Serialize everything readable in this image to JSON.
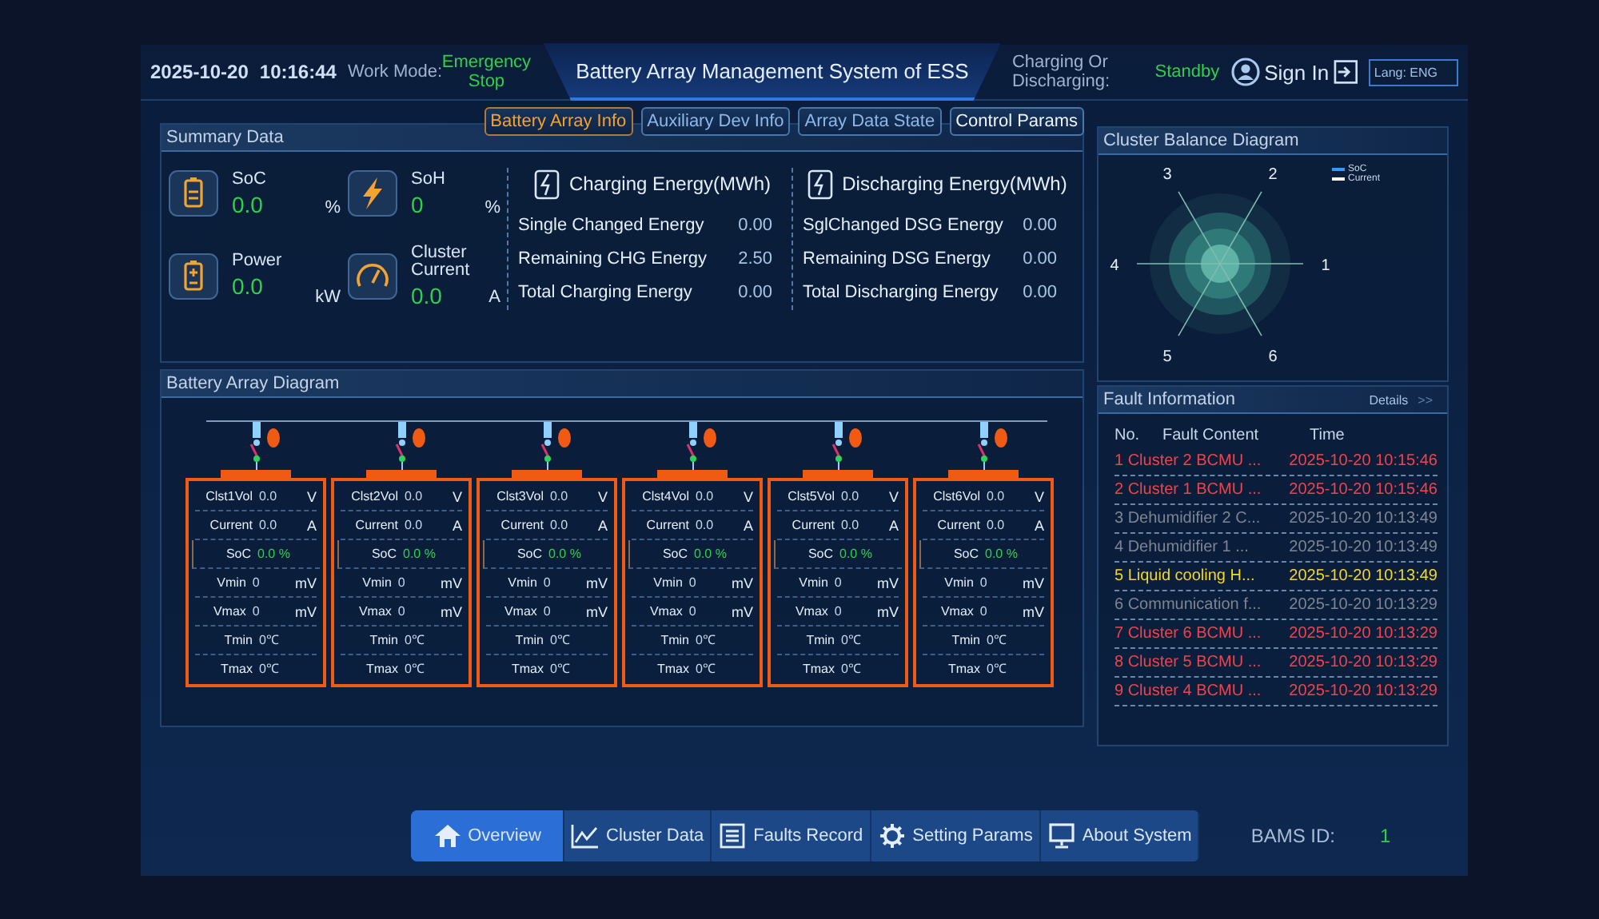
{
  "header": {
    "date": "2025-10-20",
    "time": "10:16:44",
    "work_mode_label": "Work Mode:",
    "work_mode": "Emergency Stop",
    "title": "Battery Array Management System of ESS",
    "charge_label": "Charging Or Discharging:",
    "charge_state": "Standby",
    "sign_in": "Sign In",
    "lang": "Lang: ENG"
  },
  "tabs": [
    {
      "label": "Battery Array Info",
      "selected": true
    },
    {
      "label": "Auxiliary Dev Info",
      "selected": false
    },
    {
      "label": "Array Data State",
      "selected": false
    },
    {
      "label": "Control Params",
      "selected": false
    }
  ],
  "summary": {
    "title": "Summary Data",
    "metrics": [
      {
        "kind": "battery",
        "label": "SoC",
        "value": "0.0",
        "unit": "%"
      },
      {
        "kind": "bolt",
        "label": "SoH",
        "value": "0",
        "unit": "%"
      },
      {
        "kind": "battery-plus",
        "label": "Power",
        "value": "0.0",
        "unit": "kW"
      },
      {
        "kind": "gauge",
        "label": "Cluster Current",
        "value": "0.0",
        "unit": "A"
      }
    ],
    "energy": [
      {
        "title": "Charging Energy(MWh)",
        "rows": [
          [
            "Single Changed Energy",
            "0.00"
          ],
          [
            "Remaining CHG Energy",
            "2.50"
          ],
          [
            "Total Charging Energy",
            "0.00"
          ]
        ]
      },
      {
        "title": "Discharging Energy(MWh)",
        "rows": [
          [
            "SglChanged DSG Energy",
            "0.00"
          ],
          [
            "Remaining DSG Energy",
            "0.00"
          ],
          [
            "Total Discharging Energy",
            "0.00"
          ]
        ]
      }
    ]
  },
  "array": {
    "title": "Battery Array Diagram",
    "clusters": [
      {
        "rows": [
          {
            "kind": "plain",
            "label": "Clst1Vol",
            "value": "0.0",
            "unit": "V"
          },
          {
            "kind": "plain",
            "label": "Current",
            "value": "0.0",
            "unit": "A"
          },
          {
            "kind": "soc",
            "label": "SoC",
            "value": "0.0 %"
          },
          {
            "kind": "plain",
            "label": "Vmin",
            "value": "0",
            "unit": "mV"
          },
          {
            "kind": "plain",
            "label": "Vmax",
            "value": "0",
            "unit": "mV"
          },
          {
            "kind": "plain",
            "label": "Tmin",
            "value": "0℃"
          },
          {
            "kind": "plain",
            "label": "Tmax",
            "value": "0℃"
          }
        ]
      },
      {
        "rows": [
          {
            "kind": "plain",
            "label": "Clst2Vol",
            "value": "0.0",
            "unit": "V"
          },
          {
            "kind": "plain",
            "label": "Current",
            "value": "0.0",
            "unit": "A"
          },
          {
            "kind": "soc",
            "label": "SoC",
            "value": "0.0 %"
          },
          {
            "kind": "plain",
            "label": "Vmin",
            "value": "0",
            "unit": "mV"
          },
          {
            "kind": "plain",
            "label": "Vmax",
            "value": "0",
            "unit": "mV"
          },
          {
            "kind": "plain",
            "label": "Tmin",
            "value": "0℃"
          },
          {
            "kind": "plain",
            "label": "Tmax",
            "value": "0℃"
          }
        ]
      },
      {
        "rows": [
          {
            "kind": "plain",
            "label": "Clst3Vol",
            "value": "0.0",
            "unit": "V"
          },
          {
            "kind": "plain",
            "label": "Current",
            "value": "0.0",
            "unit": "A"
          },
          {
            "kind": "soc",
            "label": "SoC",
            "value": "0.0 %"
          },
          {
            "kind": "plain",
            "label": "Vmin",
            "value": "0",
            "unit": "mV"
          },
          {
            "kind": "plain",
            "label": "Vmax",
            "value": "0",
            "unit": "mV"
          },
          {
            "kind": "plain",
            "label": "Tmin",
            "value": "0℃"
          },
          {
            "kind": "plain",
            "label": "Tmax",
            "value": "0℃"
          }
        ]
      },
      {
        "rows": [
          {
            "kind": "plain",
            "label": "Clst4Vol",
            "value": "0.0",
            "unit": "V"
          },
          {
            "kind": "plain",
            "label": "Current",
            "value": "0.0",
            "unit": "A"
          },
          {
            "kind": "soc",
            "label": "SoC",
            "value": "0.0 %"
          },
          {
            "kind": "plain",
            "label": "Vmin",
            "value": "0",
            "unit": "mV"
          },
          {
            "kind": "plain",
            "label": "Vmax",
            "value": "0",
            "unit": "mV"
          },
          {
            "kind": "plain",
            "label": "Tmin",
            "value": "0℃"
          },
          {
            "kind": "plain",
            "label": "Tmax",
            "value": "0℃"
          }
        ]
      },
      {
        "rows": [
          {
            "kind": "plain",
            "label": "Clst5Vol",
            "value": "0.0",
            "unit": "V"
          },
          {
            "kind": "plain",
            "label": "Current",
            "value": "0.0",
            "unit": "A"
          },
          {
            "kind": "soc",
            "label": "SoC",
            "value": "0.0 %"
          },
          {
            "kind": "plain",
            "label": "Vmin",
            "value": "0",
            "unit": "mV"
          },
          {
            "kind": "plain",
            "label": "Vmax",
            "value": "0",
            "unit": "mV"
          },
          {
            "kind": "plain",
            "label": "Tmin",
            "value": "0℃"
          },
          {
            "kind": "plain",
            "label": "Tmax",
            "value": "0℃"
          }
        ]
      },
      {
        "rows": [
          {
            "kind": "plain",
            "label": "Clst6Vol",
            "value": "0.0",
            "unit": "V"
          },
          {
            "kind": "plain",
            "label": "Current",
            "value": "0.0",
            "unit": "A"
          },
          {
            "kind": "soc",
            "label": "SoC",
            "value": "0.0 %"
          },
          {
            "kind": "plain",
            "label": "Vmin",
            "value": "0",
            "unit": "mV"
          },
          {
            "kind": "plain",
            "label": "Vmax",
            "value": "0",
            "unit": "mV"
          },
          {
            "kind": "plain",
            "label": "Tmin",
            "value": "0℃"
          },
          {
            "kind": "plain",
            "label": "Tmax",
            "value": "0℃"
          }
        ]
      }
    ]
  },
  "balance": {
    "title": "Cluster Balance Diagram",
    "axes": [
      "1",
      "2",
      "3",
      "4",
      "5",
      "6"
    ],
    "legend": [
      {
        "label": "SoC",
        "color": "#2f9bff"
      },
      {
        "label": "Current",
        "color": "#ffffff"
      }
    ]
  },
  "faults": {
    "title": "Fault Information",
    "details": "Details",
    "more": ">>",
    "columns": [
      "No.",
      "Fault Content",
      "Time"
    ],
    "rows": [
      {
        "no": "1",
        "content": "Cluster 2 BCMU ...",
        "time": "2025-10-20 10:15:46",
        "color": "#f0434b"
      },
      {
        "no": "2",
        "content": "Cluster 1 BCMU ...",
        "time": "2025-10-20 10:15:46",
        "color": "#f0434b"
      },
      {
        "no": "3",
        "content": "Dehumidifier 2 C...",
        "time": "2025-10-20 10:13:49",
        "color": "#7d8593"
      },
      {
        "no": "4",
        "content": "Dehumidifier 1 ...",
        "time": "2025-10-20 10:13:49",
        "color": "#7d8593"
      },
      {
        "no": "5",
        "content": "Liquid cooling H...",
        "time": "2025-10-20 10:13:49",
        "color": "#f2d62e"
      },
      {
        "no": "6",
        "content": "Communication f...",
        "time": "2025-10-20 10:13:29",
        "color": "#7d8593"
      },
      {
        "no": "7",
        "content": "Cluster 6 BCMU ...",
        "time": "2025-10-20 10:13:29",
        "color": "#f0434b"
      },
      {
        "no": "8",
        "content": "Cluster 5 BCMU ...",
        "time": "2025-10-20 10:13:29",
        "color": "#f0434b"
      },
      {
        "no": "9",
        "content": "Cluster 4 BCMU ...",
        "time": "2025-10-20 10:13:29",
        "color": "#f0434b"
      }
    ]
  },
  "nav": [
    {
      "kind": "home",
      "label": "Overview",
      "selected": true
    },
    {
      "kind": "chart",
      "label": "Cluster Data",
      "selected": false
    },
    {
      "kind": "list",
      "label": "Faults Record",
      "selected": false
    },
    {
      "kind": "gear",
      "label": "Setting Params",
      "selected": false
    },
    {
      "kind": "monitor",
      "label": "About System",
      "selected": false
    }
  ],
  "bams": {
    "label": "BAMS ID:",
    "value": "1"
  }
}
